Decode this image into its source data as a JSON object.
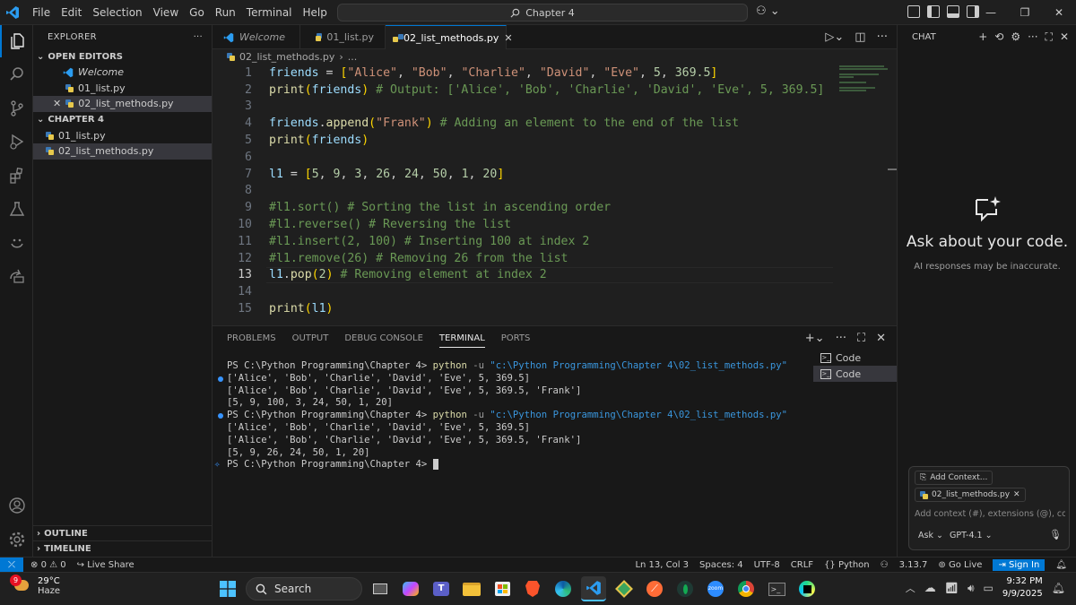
{
  "titlebar": {
    "menu": [
      "File",
      "Edit",
      "Selection",
      "View",
      "Go",
      "Run",
      "Terminal",
      "Help"
    ],
    "command_center": "Chapter 4"
  },
  "sidebar": {
    "title": "EXPLORER",
    "open_editors_label": "OPEN EDITORS",
    "open_editors": [
      "Welcome",
      "01_list.py",
      "02_list_methods.py"
    ],
    "folder_label": "CHAPTER 4",
    "files": [
      "01_list.py",
      "02_list_methods.py"
    ],
    "outline_label": "OUTLINE",
    "timeline_label": "TIMELINE"
  },
  "tabs": [
    "Welcome",
    "01_list.py",
    "02_list_methods.py"
  ],
  "breadcrumb": {
    "file": "02_list_methods.py",
    "rest": "..."
  },
  "code": {
    "current_line": 13,
    "line_numbers": [
      "1",
      "2",
      "3",
      "4",
      "5",
      "6",
      "7",
      "8",
      "9",
      "10",
      "11",
      "12",
      "13",
      "14",
      "15"
    ]
  },
  "panel": {
    "tabs": [
      "PROBLEMS",
      "OUTPUT",
      "DEBUG CONSOLE",
      "TERMINAL",
      "PORTS"
    ],
    "terminal": {
      "prompt": "PS C:\\Python Programming\\Chapter 4> ",
      "cmd": "python",
      "flag": " -u ",
      "arg": "\"c:\\Python Programming\\Chapter 4\\02_list_methods.py\"",
      "run1": [
        "['Alice', 'Bob', 'Charlie', 'David', 'Eve', 5, 369.5]",
        "['Alice', 'Bob', 'Charlie', 'David', 'Eve', 5, 369.5, 'Frank']",
        "[5, 9, 100, 3, 24, 50, 1, 20]"
      ],
      "run2": [
        "['Alice', 'Bob', 'Charlie', 'David', 'Eve', 5, 369.5]",
        "['Alice', 'Bob', 'Charlie', 'David', 'Eve', 5, 369.5, 'Frank']",
        "[5, 9, 26, 24, 50, 1, 20]"
      ],
      "final_prompt": "PS C:\\Python Programming\\Chapter 4> "
    },
    "terminal_list": [
      "Code",
      "Code"
    ]
  },
  "chat": {
    "header": "CHAT",
    "title": "Ask about your code.",
    "subtitle": "AI responses may be inaccurate.",
    "add_context": "Add Context...",
    "file_chip": "02_list_methods.py",
    "placeholder": "Add context (#), extensions (@), com",
    "mode": "Ask",
    "model": "GPT-4.1"
  },
  "statusbar": {
    "errors": "0",
    "warnings": "0",
    "live_share": "Live Share",
    "position": "Ln 13, Col 3",
    "spaces": "Spaces: 4",
    "encoding": "UTF-8",
    "eol": "CRLF",
    "language": "Python",
    "python_version": "3.13.7",
    "go_live": "Go Live",
    "sign_in": "Sign In"
  },
  "taskbar": {
    "temperature": "29°C",
    "weather": "Haze",
    "badge": "9",
    "search": "Search",
    "time": "9:32 PM",
    "date": "9/9/2025"
  },
  "colors": {
    "accent": "#0078d4",
    "background": "#1f1f1f"
  }
}
